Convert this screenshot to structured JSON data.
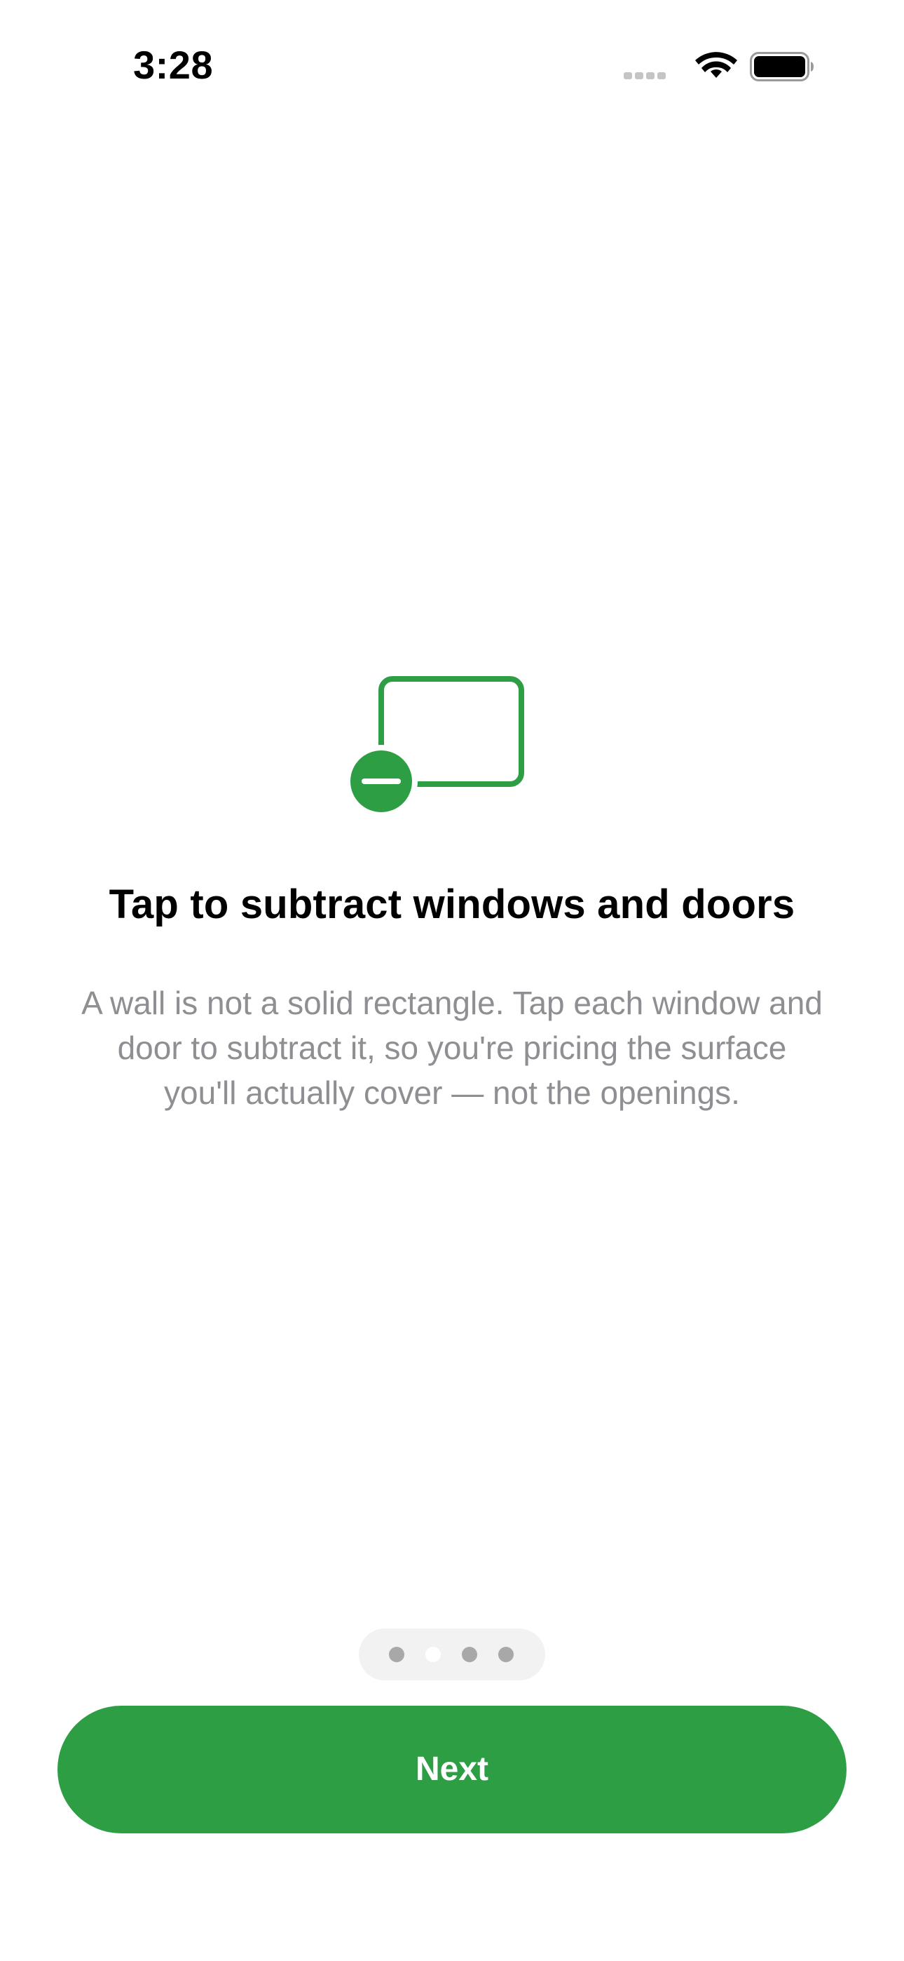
{
  "status_bar": {
    "time": "3:28",
    "icons": [
      "cellular-signal-icon",
      "wifi-icon",
      "battery-icon"
    ]
  },
  "onboarding": {
    "icon": "subtract-window-icon",
    "title": "Tap to subtract windows and doors",
    "description": "A wall is not a solid rectangle. Tap each window and door to subtract it, so you're pricing the surface you'll actually cover — not the openings.",
    "page_indicator": {
      "total": 4,
      "current": 2
    },
    "next_label": "Next"
  },
  "colors": {
    "accent": "#2e9e44",
    "description_text": "#8e8e93",
    "background": "#ffffff"
  }
}
